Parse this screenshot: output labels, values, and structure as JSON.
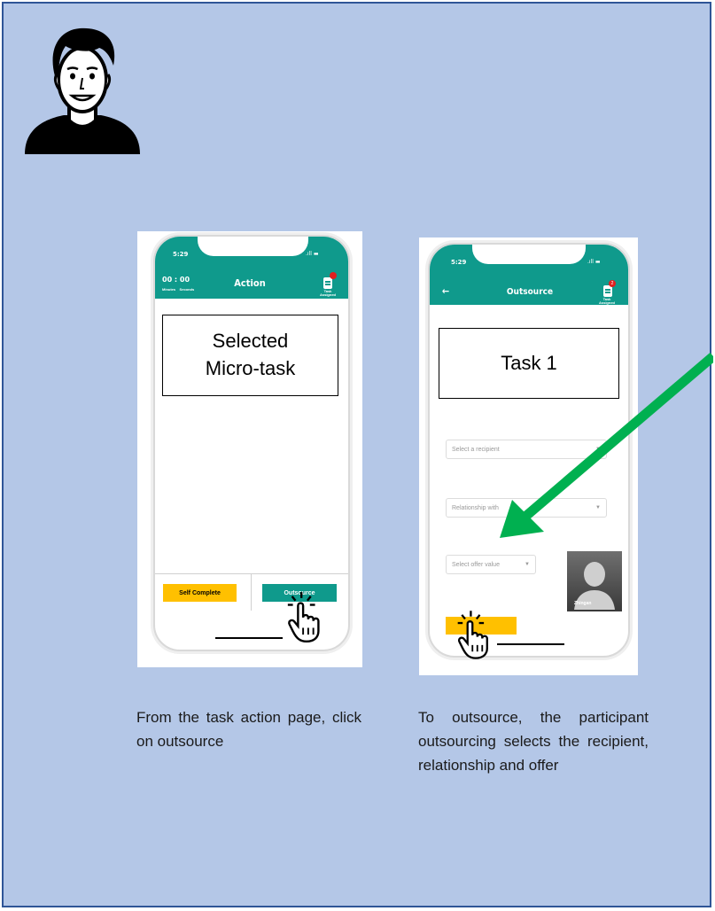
{
  "screen1": {
    "status_time": "5:29",
    "status_signal": ".ıll ▬",
    "timer": "00 : 00",
    "timer_labels": "Minutes    Seconds",
    "title": "Action",
    "task_assigned": "Task Assigned",
    "box_text": "Selected\nMicro-task",
    "self_complete_label": "Self Complete",
    "outsource_label": "Outsource"
  },
  "screen2": {
    "status_time": "5:29",
    "status_signal": ".ıll ▬",
    "title": "Outsource",
    "badge_count": "2",
    "task_assigned": "Task Assigned",
    "box_text": "Task 1",
    "recipient_placeholder": "Select a recipient",
    "relationship_placeholder": "Relationship with",
    "offer_placeholder": "Select offer value",
    "profile_name": "Zhingan"
  },
  "caption1": "From the task action page, click on outsource",
  "caption2": "To outsource, the participant outsourcing selects the recipient, relationship and offer",
  "colors": {
    "background": "#b4c7e7",
    "border": "#2f5597",
    "header": "#0f9a8c",
    "yellow": "#ffc000",
    "arrow": "#00b050"
  }
}
